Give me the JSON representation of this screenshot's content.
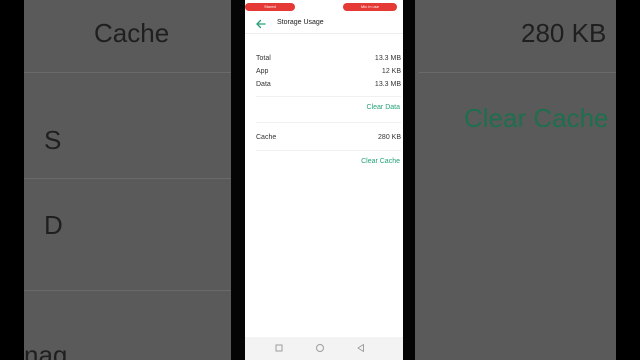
{
  "background": {
    "cache_label": "Cache",
    "cache_value": "280 KB",
    "clear_cache_label": "Clear Cache",
    "fragment_s": "S",
    "fragment_d": "D",
    "fragment_nag": "nag"
  },
  "status_bar": {
    "left_pill": "Stored",
    "right_pill": "Mic in use"
  },
  "header": {
    "title": "Storage Usage"
  },
  "storage": {
    "rows": [
      {
        "label": "Total",
        "value": "13.3 MB"
      },
      {
        "label": "App",
        "value": "12 KB"
      },
      {
        "label": "Data",
        "value": "13.3 MB"
      }
    ],
    "clear_data_label": "Clear Data"
  },
  "cache": {
    "label": "Cache",
    "value": "280 KB",
    "clear_cache_label": "Clear Cache"
  },
  "colors": {
    "accent": "#25a276",
    "status_pill": "#e53935"
  },
  "icons": {
    "back": "arrow-left-icon",
    "nav_recents": "square-icon",
    "nav_home": "circle-icon",
    "nav_back": "triangle-icon"
  }
}
